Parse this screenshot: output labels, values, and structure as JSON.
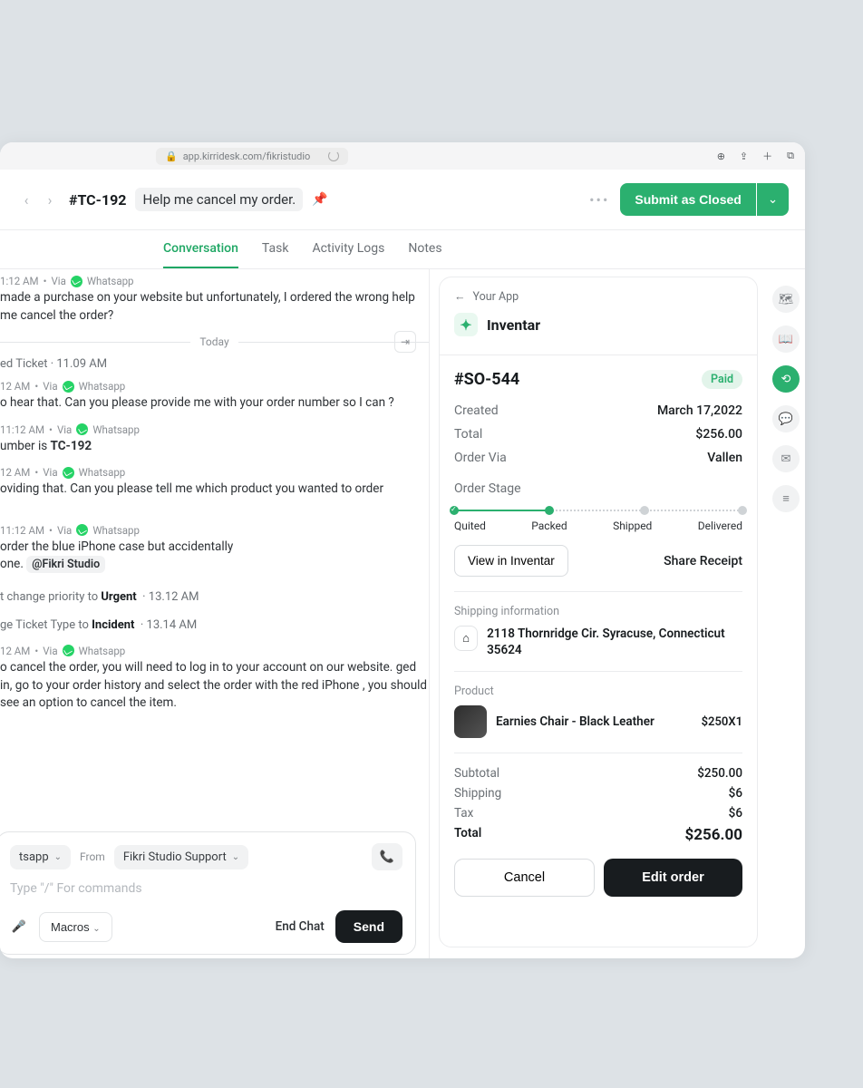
{
  "browser": {
    "url": "app.kirridesk.com/fikristudio"
  },
  "header": {
    "ticket_id": "#TC-192",
    "title": "Help me cancel my order.",
    "submit_label": "Submit as Closed"
  },
  "tabs": [
    "Conversation",
    "Task",
    "Activity Logs",
    "Notes"
  ],
  "chat": {
    "msg0": {
      "time": "1:12 AM",
      "via": "Via",
      "channel": "Whatsapp",
      "text": "made a purchase on your website but unfortunately, I ordered the wrong help me cancel the order?"
    },
    "day_divider": "Today",
    "sys1": {
      "text_a": "ed Ticket  ·  ",
      "time": "11.09 AM"
    },
    "msg1": {
      "time": "12 AM",
      "via": "Via",
      "channel": "Whatsapp",
      "text": "o hear that. Can you please provide me with your order number so I can ?"
    },
    "msg2": {
      "time": "11:12 AM",
      "via": "Via",
      "channel": "Whatsapp",
      "text_a": "umber is ",
      "bold": "TC-192"
    },
    "msg3": {
      "time": "12 AM",
      "via": "Via",
      "channel": "Whatsapp",
      "text": "oviding that. Can you please tell me which product you wanted to order"
    },
    "msg4": {
      "time": "11:12 AM",
      "via": "Via",
      "channel": "Whatsapp",
      "text_a": "order the blue iPhone case but accidentally",
      "text_b": "one.  ",
      "mention": "@Fikri Studio"
    },
    "sys2": {
      "text_a": "t change priority to ",
      "bold": "Urgent",
      "time": "13.12 AM"
    },
    "sys3": {
      "text_a": "ge Ticket Type to ",
      "bold": "Incident",
      "time": "13.14 AM"
    },
    "msg5": {
      "time": "12 AM",
      "via": "Via",
      "channel": "Whatsapp",
      "text": "o cancel the order, you will need to log in to your account on our website. ged in, go to your order history and select the order with the red iPhone , you should see an option to cancel the item."
    }
  },
  "compose": {
    "channel": "tsapp",
    "from_label": "From",
    "from_value": "Fikri Studio Support",
    "placeholder": "Type \"/\" For commands",
    "macros": "Macros",
    "end_chat": "End Chat",
    "send": "Send"
  },
  "order": {
    "breadcrumb": "Your App",
    "app_name": "Inventar",
    "id": "#SO-544",
    "status": "Paid",
    "created_label": "Created",
    "created_value": "March 17,2022",
    "total_label": "Total",
    "total_value": "$256.00",
    "via_label": "Order Via",
    "via_value": "Vallen",
    "stage_label": "Order Stage",
    "stages": [
      "Quited",
      "Packed",
      "Shipped",
      "Delivered"
    ],
    "view_btn": "View in Inventar",
    "share_btn": "Share Receipt",
    "ship_label": "Shipping information",
    "ship_addr": "2118 Thornridge Cir. Syracuse, Connecticut 35624",
    "product_label": "Product",
    "product_name": "Earnies Chair - Black Leather",
    "product_price": "$250X1",
    "subtotal_label": "Subtotal",
    "subtotal_value": "$250.00",
    "shipping_label": "Shipping",
    "shipping_value": "$6",
    "tax_label": "Tax",
    "tax_value": "$6",
    "grand_label": "Total",
    "grand_value": "$256.00",
    "cancel_btn": "Cancel",
    "edit_btn": "Edit order"
  }
}
